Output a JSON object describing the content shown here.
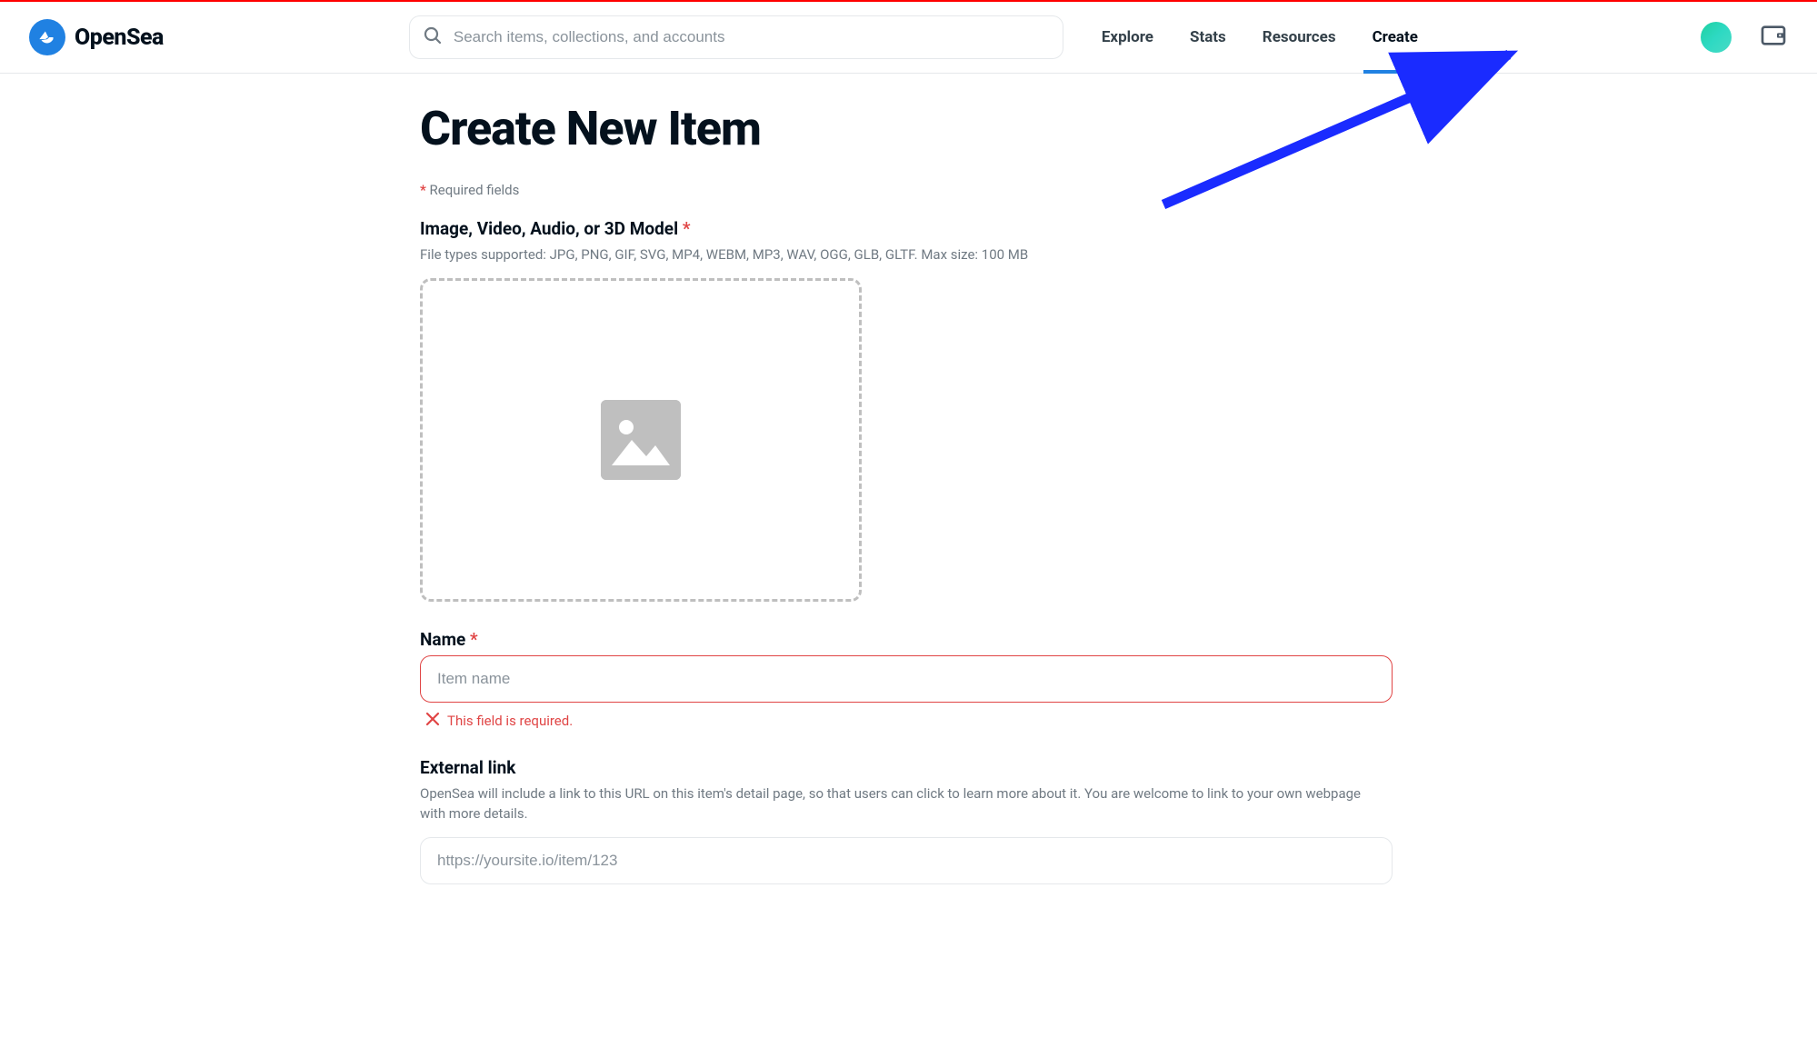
{
  "brand": {
    "name": "OpenSea"
  },
  "search": {
    "placeholder": "Search items, collections, and accounts"
  },
  "nav": {
    "explore": "Explore",
    "stats": "Stats",
    "resources": "Resources",
    "create": "Create"
  },
  "page": {
    "title": "Create New Item",
    "required_note": "Required fields"
  },
  "upload": {
    "label": "Image, Video, Audio, or 3D Model",
    "help": "File types supported: JPG, PNG, GIF, SVG, MP4, WEBM, MP3, WAV, OGG, GLB, GLTF. Max size: 100 MB"
  },
  "name_field": {
    "label": "Name",
    "placeholder": "Item name",
    "error": "This field is required."
  },
  "external_link": {
    "label": "External link",
    "help": "OpenSea will include a link to this URL on this item's detail page, so that users can click to learn more about it. You are welcome to link to your own webpage with more details.",
    "placeholder": "https://yoursite.io/item/123"
  }
}
